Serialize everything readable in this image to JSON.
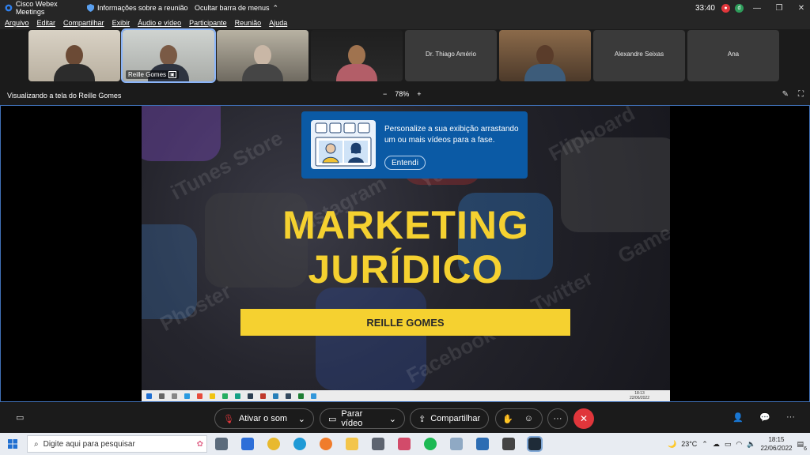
{
  "titlebar": {
    "app_title": "Cisco Webex Meetings",
    "meeting_info": "Informações sobre a reunião",
    "hide_menu": "Ocultar barra de menus",
    "elapsed": "33:40"
  },
  "menu": [
    "Arquivo",
    "Editar",
    "Compartilhar",
    "Exibir",
    "Áudio e vídeo",
    "Participante",
    "Reunião",
    "Ajuda"
  ],
  "participants": [
    {
      "name": "",
      "type": "video"
    },
    {
      "name": "Reille Gomes",
      "type": "video",
      "active": true
    },
    {
      "name": "",
      "type": "video"
    },
    {
      "name": "",
      "type": "video"
    },
    {
      "name": "Dr. Thiago Amério",
      "type": "name"
    },
    {
      "name": "",
      "type": "video"
    },
    {
      "name": "Alexandre Seixas",
      "type": "name"
    },
    {
      "name": "Ana",
      "type": "name"
    }
  ],
  "share": {
    "viewing": "Visualizando a tela do Reille Gomes",
    "zoom": "78%",
    "minus": "−",
    "plus": "+"
  },
  "slide": {
    "line1": "MARKETING",
    "line2": "JURÍDICO",
    "presenter": "REILLE GOMES",
    "bg_words": [
      "iTunes Store",
      "Instagram",
      "Phoster",
      "Facebook",
      "Twitter",
      "Game",
      "Yelp",
      "Flipboard"
    ],
    "inner_time": "18:13",
    "inner_date": "22/06/2022"
  },
  "tooltip": {
    "message": "Personalize a sua exibição arrastando um ou mais vídeos para a fase.",
    "button": "Entendi"
  },
  "controls": {
    "mute_label": "Ativar o som",
    "video_label": "Parar vídeo",
    "share_label": "Compartilhar",
    "more": "···"
  },
  "taskbar": {
    "search_placeholder": "Digite aqui para pesquisar",
    "weather": "23°C",
    "time": "18:15",
    "date": "22/06/2022",
    "notif_count": "6"
  },
  "colors": {
    "accent_yellow": "#f5d130",
    "tooltip_blue": "#0b5aa5",
    "end_red": "#e0363b",
    "stage_border": "#3f6fb5"
  }
}
